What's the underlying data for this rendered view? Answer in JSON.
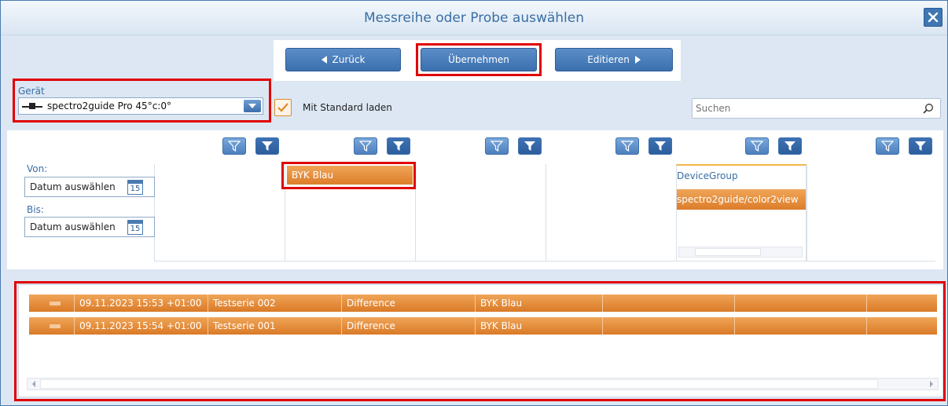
{
  "window": {
    "title": "Messreihe oder Probe auswählen",
    "close_icon": "close-icon"
  },
  "nav": {
    "back_label": "Zurück",
    "apply_label": "Übernehmen",
    "edit_label": "Editieren"
  },
  "device": {
    "label": "Gerät",
    "selected": "spectro2guide Pro 45°c:0°",
    "icon": "device-icon"
  },
  "standard": {
    "checked": true,
    "label": "Mit Standard laden"
  },
  "search": {
    "placeholder": "Suchen",
    "value": ""
  },
  "date_filter": {
    "from_label": "Von:",
    "from_value": "Datum auswählen",
    "to_label": "Bis:",
    "to_value": "Datum auswählen",
    "calendar_day": "15"
  },
  "columns": {
    "col2_item": "BYK Blau",
    "col5_header": "DeviceGroup",
    "col5_item": "spectro2guide/color2view"
  },
  "results": {
    "rows": [
      {
        "timestamp": "09.11.2023 15:53 +01:00",
        "name": "Testserie 002",
        "type": "Difference",
        "standard": "BYK Blau"
      },
      {
        "timestamp": "09.11.2023 15:54 +01:00",
        "name": "Testserie 001",
        "type": "Difference",
        "standard": "BYK Blau"
      }
    ]
  },
  "colors": {
    "accent_blue": "#3a6ea5",
    "selection_orange": "#dc7d2a",
    "highlight_red": "#e00000"
  }
}
